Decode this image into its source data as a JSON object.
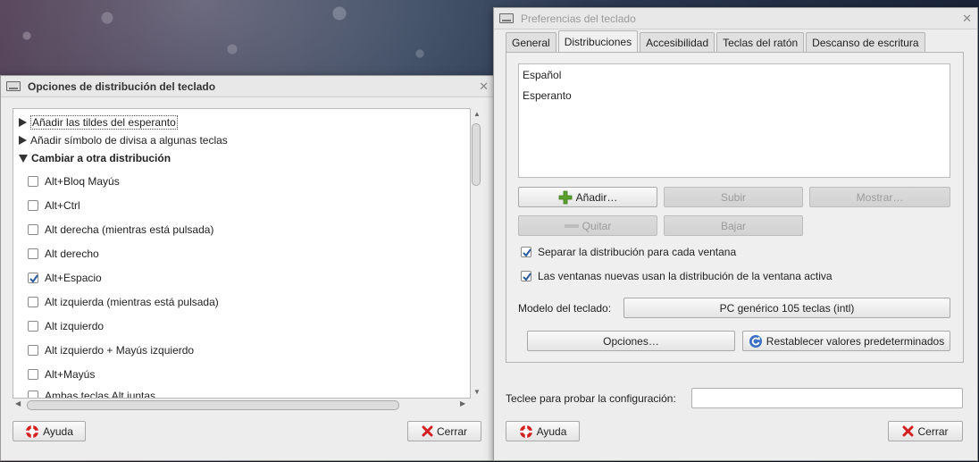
{
  "left_window": {
    "title": "Opciones de distribución del teclado",
    "tree": [
      {
        "label": "Añadir las tildes del esperanto",
        "expanded": false,
        "focused": true
      },
      {
        "label": "Añadir símbolo de divisa a algunas teclas",
        "expanded": false
      },
      {
        "label": "Cambiar a otra distribución",
        "expanded": true
      }
    ],
    "options": [
      {
        "label": "Alt+Bloq Mayús",
        "checked": false
      },
      {
        "label": "Alt+Ctrl",
        "checked": false
      },
      {
        "label": "Alt derecha (mientras está pulsada)",
        "checked": false
      },
      {
        "label": "Alt derecho",
        "checked": false
      },
      {
        "label": "Alt+Espacio",
        "checked": true
      },
      {
        "label": "Alt izquierda (mientras está pulsada)",
        "checked": false
      },
      {
        "label": "Alt izquierdo",
        "checked": false
      },
      {
        "label": "Alt izquierdo + Mayús izquierdo",
        "checked": false
      },
      {
        "label": "Alt+Mayús",
        "checked": false
      },
      {
        "label": "Ambas teclas Alt juntas",
        "checked": false
      }
    ],
    "help_label": "Ayuda",
    "close_label": "Cerrar"
  },
  "right_window": {
    "title": "Preferencias del teclado",
    "tabs": [
      "General",
      "Distribuciones",
      "Accesibilidad",
      "Teclas del ratón",
      "Descanso de escritura"
    ],
    "active_tab": "Distribuciones",
    "layouts": [
      "Español",
      "Esperanto"
    ],
    "buttons": {
      "add": "Añadir…",
      "up": "Subir",
      "show": "Mostrar…",
      "remove": "Quitar",
      "down": "Bajar",
      "options": "Opciones…",
      "reset": "Restablecer valores predeterminados"
    },
    "checks": {
      "separate": {
        "label": "Separar la distribución para cada ventana",
        "checked": true
      },
      "new_windows": {
        "label": "Las ventanas nuevas usan la distribución de la ventana activa",
        "checked": true
      }
    },
    "model_label": "Modelo del teclado:",
    "model_value": "PC genérico 105 teclas (intl)",
    "test_label": "Teclee para probar la configuración:",
    "test_value": "",
    "help_label": "Ayuda",
    "close_label": "Cerrar"
  },
  "icons": {
    "help": "lifebuoy-icon",
    "close": "red-x-icon",
    "add": "green-plus-icon",
    "remove": "minus-icon",
    "reset": "refresh-icon",
    "keyboard": "keyboard-icon"
  },
  "colors": {
    "check": "#2c5aa0",
    "add_green": "#5aa02c",
    "close_red": "#d42020",
    "reset_blue": "#3a6fc4"
  }
}
